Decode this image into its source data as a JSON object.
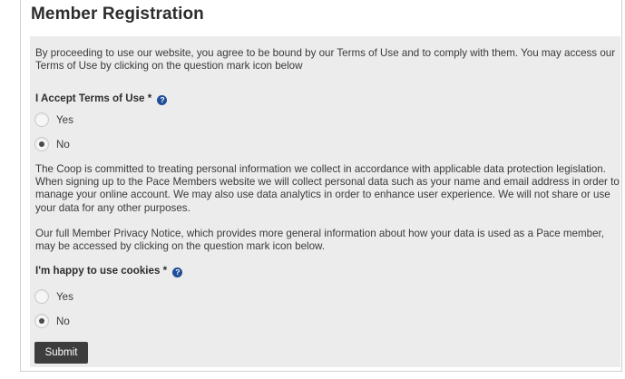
{
  "form": {
    "title": "Member Registration",
    "intro_text": "By proceeding to use our website, you agree to be bound by our Terms of Use and to comply with them. You may access our Terms of Use by clicking on the question mark icon below",
    "terms_question": {
      "label": "I Accept Terms of Use *",
      "options": [
        "Yes",
        "No"
      ],
      "selected": "No"
    },
    "privacy_text": "The Coop is committed to treating personal information we collect in accordance with applicable data protection legislation. When signing up to the Pace Members website we will collect personal data such as your name and email address in order to manage your online account. We may also use data analytics in order to enhance user experience. We will not share or use your data for any other purposes.",
    "privacy_notice_text": "Our full Member Privacy Notice, which provides more general information about how your data is used as a Pace member, may be accessed by clicking on the question mark icon below.",
    "cookies_question": {
      "label": "I'm happy to use cookies *",
      "options": [
        "Yes",
        "No"
      ],
      "selected": "No"
    },
    "help_icon_glyph": "?",
    "submit_label": "Submit"
  },
  "colors": {
    "panel_background": "#ececec",
    "help_icon": "#1f4e9a",
    "submit_button": "#3d3d3d"
  },
  "icons": [
    "question-mark-icon"
  ]
}
